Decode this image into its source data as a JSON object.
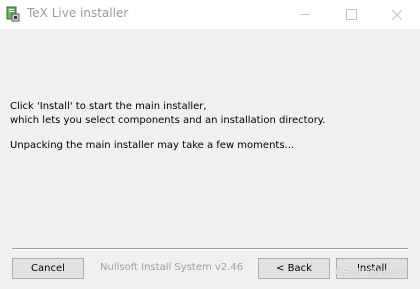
{
  "window": {
    "title": "TeX Live installer",
    "icon": "installer-icon",
    "controls": [
      "minimize-icon",
      "maximize-icon",
      "close-icon"
    ]
  },
  "message": {
    "line1": "Click 'Install' to start the main installer,",
    "line2": "which lets you select components and an installation directory.",
    "line3": "Unpacking the main installer may take a few moments..."
  },
  "footer": {
    "cancel_label": "Cancel",
    "branding": "Nullsoft Install System v2.46",
    "back_label": "< Back",
    "install_label": "Install",
    "watermark": "CSDN @nouor"
  },
  "colors": {
    "titlebar": "#ffffff",
    "body": "#f0f0f0",
    "button_face": "#e1e1e1",
    "disabled_text": "#a0a0a0"
  }
}
